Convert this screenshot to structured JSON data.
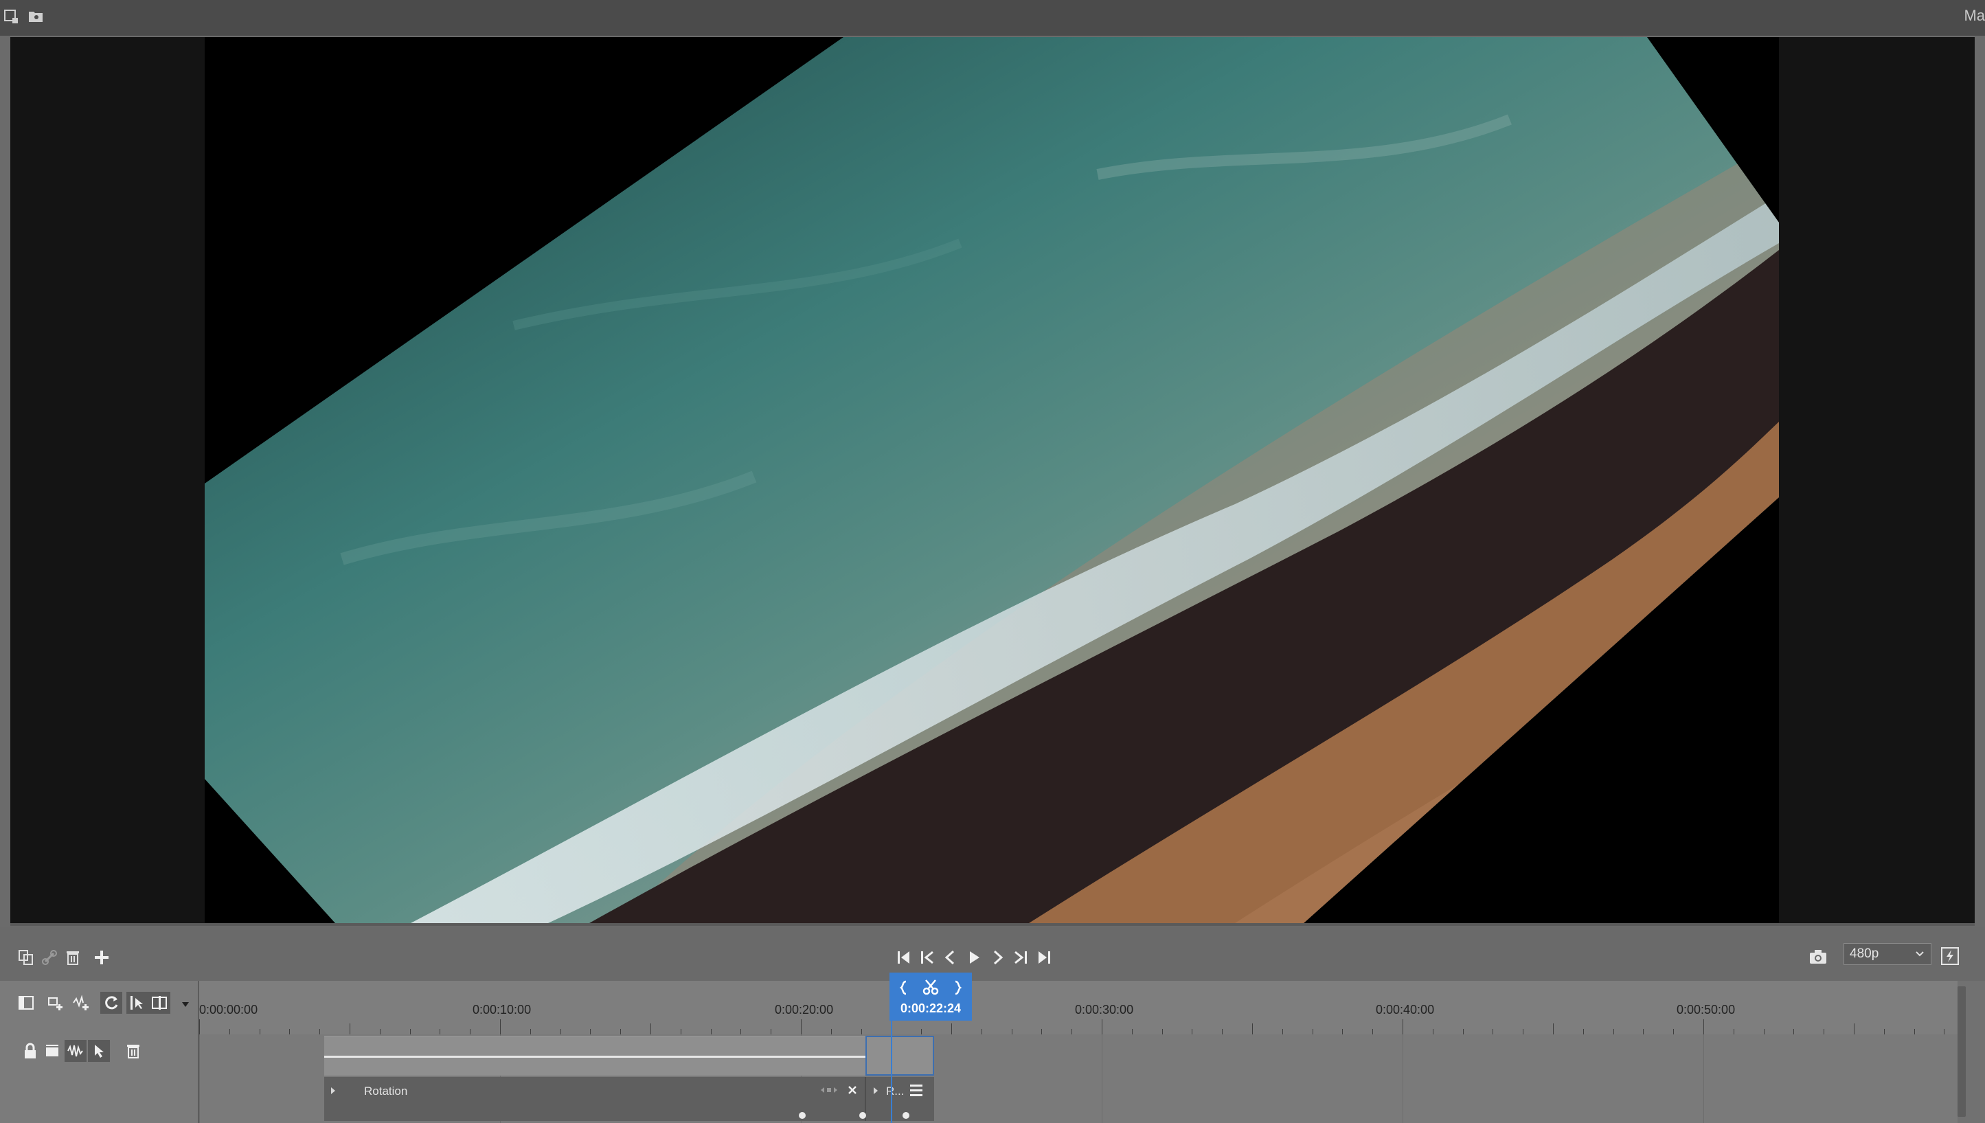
{
  "topbar": {
    "icons": [
      "new-project-icon",
      "open-folder-icon"
    ],
    "right_menu_cut": "Ma"
  },
  "preview": {
    "description_icons": []
  },
  "transport": {
    "buttons": [
      "skip-to-start",
      "previous-keyframe",
      "step-back",
      "play",
      "step-forward",
      "next-keyframe",
      "skip-to-end"
    ],
    "quality": "480p"
  },
  "timeline": {
    "ruler_labels": [
      "0:00:00:00",
      "0:00:10:00",
      "0:00:20:00",
      "0:00:30:00",
      "0:00:40:00",
      "0:00:50:00"
    ],
    "playhead_time": "0:00:22:24",
    "keyframe_track_label": "Rotation",
    "keyframe_right_label": "R..."
  },
  "colors": {
    "accent": "#3a7ed1",
    "background": "#6b6b6b",
    "topbar": "#4b4b4b"
  }
}
